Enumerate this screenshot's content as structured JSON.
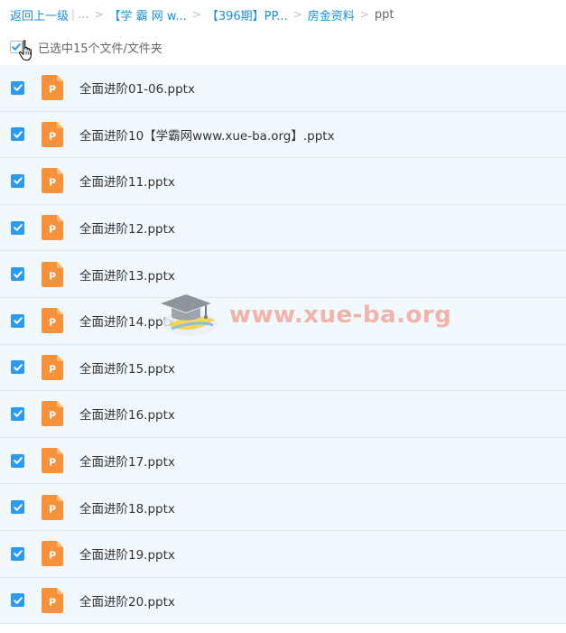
{
  "breadcrumb": {
    "back": "返回上一级",
    "divider": "|",
    "ellipsis": "...",
    "separator": ">",
    "crumbs": [
      "【学 霸 网 w...",
      "【396期】PP...",
      "房金资料"
    ],
    "current": "ppt"
  },
  "selection": {
    "label": "已选中15个文件/文件夹"
  },
  "colors": {
    "link": "#1a8fd8",
    "checkbox": "#2b9af3",
    "row_bg": "#f1f8fe",
    "file_icon": "#f7923b",
    "watermark_text": "#f2a394"
  },
  "file_icon": {
    "name": "powerpoint-file-icon",
    "letter": "P"
  },
  "files": [
    {
      "name": "全面进阶01-06.pptx"
    },
    {
      "name": "全面进阶10【学霸网www.xue-ba.org】.pptx"
    },
    {
      "name": "全面进阶11.pptx"
    },
    {
      "name": "全面进阶12.pptx"
    },
    {
      "name": "全面进阶13.pptx"
    },
    {
      "name": "全面进阶14.pptx"
    },
    {
      "name": "全面进阶15.pptx"
    },
    {
      "name": "全面进阶16.pptx"
    },
    {
      "name": "全面进阶17.pptx"
    },
    {
      "name": "全面进阶18.pptx"
    },
    {
      "name": "全面进阶19.pptx"
    },
    {
      "name": "全面进阶20.pptx"
    }
  ],
  "watermark": {
    "text": "www.xue-ba.org"
  }
}
